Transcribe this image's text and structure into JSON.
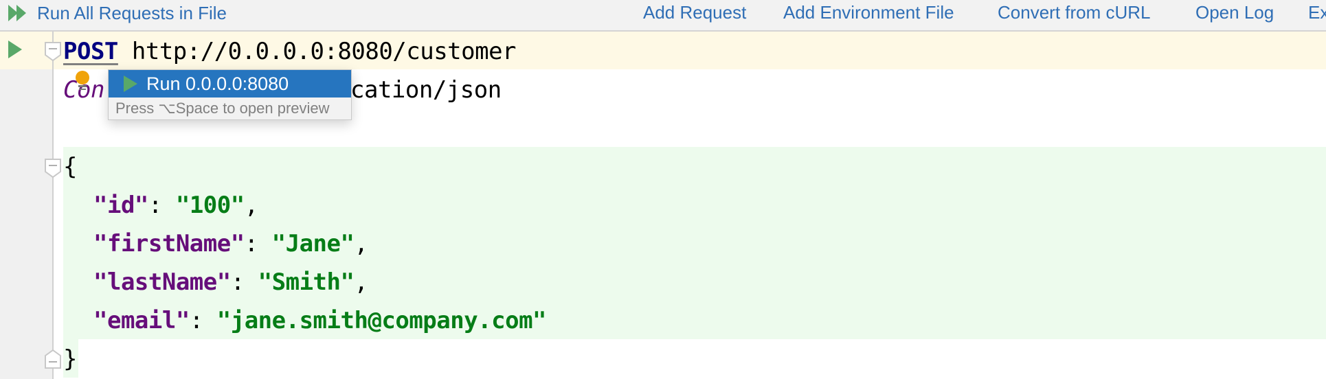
{
  "toolbar": {
    "run_all": "Run All Requests in File",
    "items": [
      {
        "label": "Add Request"
      },
      {
        "label": "Add Environment File"
      },
      {
        "label": "Convert from cURL"
      },
      {
        "label": "Open Log"
      },
      {
        "label": "Ex"
      }
    ]
  },
  "request": {
    "method": "POST",
    "url": "http://0.0.0.0:8080/customer",
    "header_name_visible": "Con",
    "header_value_visible": "cation/json",
    "body": {
      "open_brace": "{",
      "close_brace": "}",
      "fields": [
        {
          "key": "\"id\"",
          "value": "\"100\"",
          "comma": ","
        },
        {
          "key": "\"firstName\"",
          "value": "\"Jane\"",
          "comma": ","
        },
        {
          "key": "\"lastName\"",
          "value": "\"Smith\"",
          "comma": ","
        },
        {
          "key": "\"email\"",
          "value": "\"jane.smith@company.com\"",
          "comma": ""
        }
      ]
    }
  },
  "popup": {
    "item_label": "Run 0.0.0.0:8080",
    "hint": "Press ⌥Space to open preview"
  },
  "icons": {
    "run_all": "double-play-icon",
    "run_request": "play-icon",
    "intention": "lightbulb-icon",
    "fold": "fold-minus-icon"
  },
  "colors": {
    "link": "#2f6eb5",
    "run_green": "#59a869",
    "popup_selected": "#2675bf",
    "json_key": "#660e7a",
    "json_string": "#067d17",
    "http_method": "#000080"
  }
}
